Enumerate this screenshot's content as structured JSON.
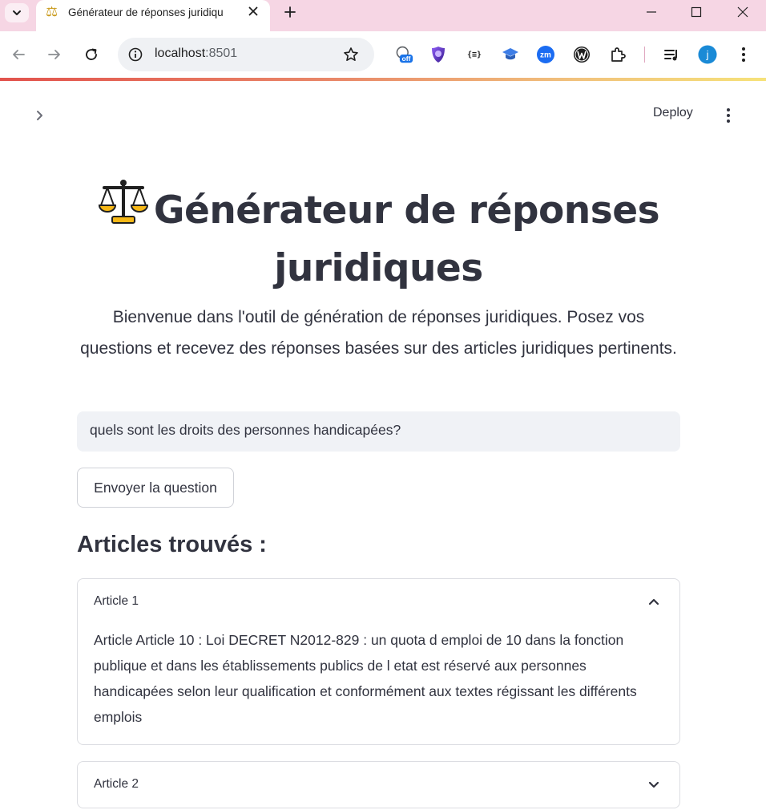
{
  "browser": {
    "tab_title": "Générateur de réponses juridiqu",
    "tab_favicon": "⚖",
    "url_host": "localhost",
    "url_port": ":8501",
    "extensions": [
      "off-extension-icon",
      "purple-shield-extension-icon",
      "json-formatter-extension-icon",
      "graduation-cap-extension-icon",
      "zm-extension-icon",
      "wordpress-extension-icon",
      "extensions-puzzle-icon",
      "reading-list-icon",
      "profile-avatar"
    ],
    "extension_labels": {
      "off_badge": "off",
      "json": "{≡}",
      "zm": "zm",
      "profile": "j"
    }
  },
  "app": {
    "deploy_label": "Deploy",
    "title_icon": "scale-icon",
    "title_text": "Générateur de réponses juridiques",
    "intro": "Bienvenue dans l'outil de génération de réponses juridiques. Posez vos questions et recevez des réponses basées sur des articles juridiques pertinents.",
    "question_value": "quels sont les droits des personnes handicapées?",
    "send_button_label": "Envoyer la question",
    "section_heading": "Articles trouvés :",
    "articles": [
      {
        "label": "Article 1",
        "expanded": true,
        "content": "Article Article 10 : Loi DECRET N2012-829 : un quota d emploi de 10 dans la fonction publique et dans les établissements publics de l etat est réservé aux personnes handicapées selon leur qualification et conformément aux textes régissant les différents emplois"
      },
      {
        "label": "Article 2",
        "expanded": false,
        "content": ""
      }
    ]
  },
  "colors": {
    "tabbar_bg": "#f6d6e4",
    "text_primary": "#31333f",
    "input_bg": "#f0f2f6",
    "border": "#dcdde2",
    "accent_gradient_start": "#e2534d",
    "accent_gradient_end": "#f6e27a"
  }
}
